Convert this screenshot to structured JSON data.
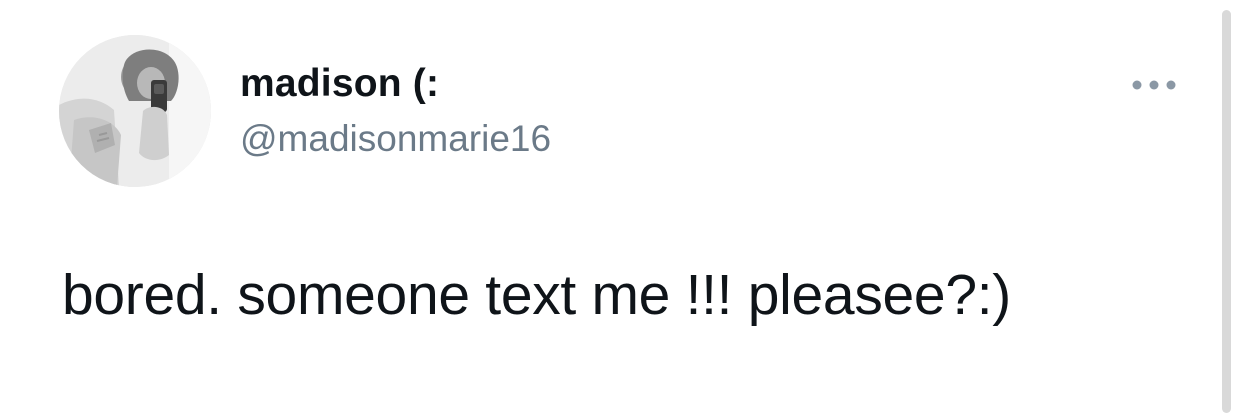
{
  "tweet": {
    "display_name": "madison (:",
    "handle": "@madisonmarie16",
    "text": "bored. someone text me !!! pleasee?:)"
  },
  "icons": {
    "more": "more-dots-icon",
    "avatar": "profile-photo"
  },
  "colors": {
    "name": "#0f1419",
    "handle": "#6b7a88",
    "more_icon": "#8b98a5",
    "scrollbar": "#d9d9d9"
  }
}
